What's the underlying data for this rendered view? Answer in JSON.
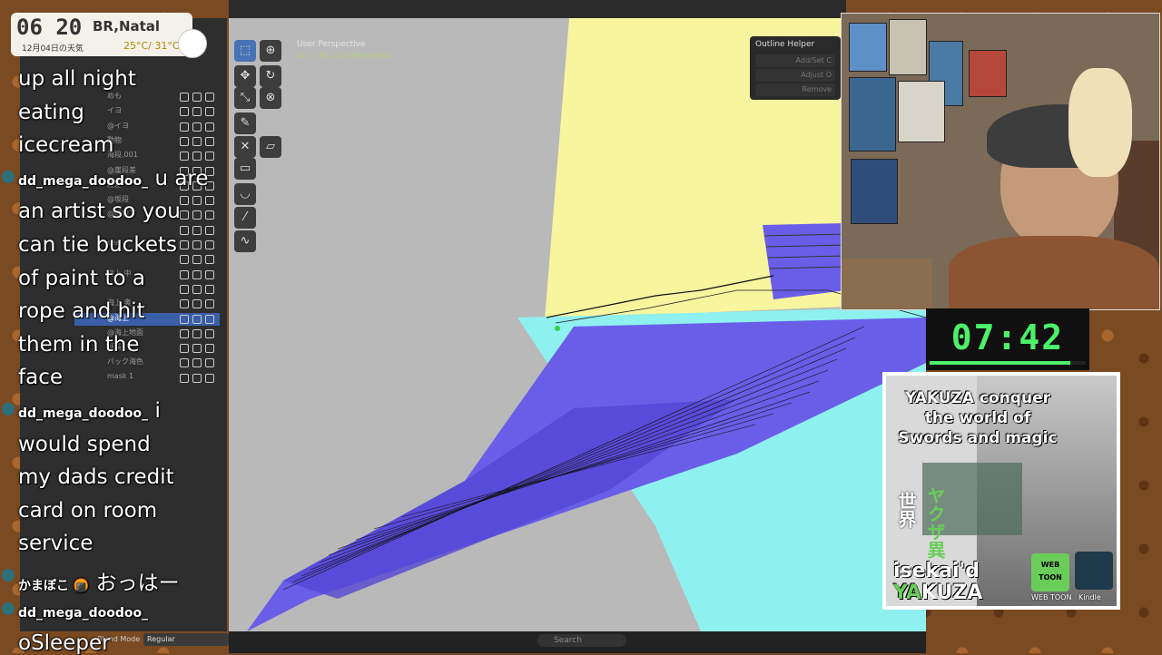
{
  "weather": {
    "time": "06 20",
    "city": "BR,Natal",
    "date": "12月04日の天気",
    "temp": "25°C/ 31°C"
  },
  "viewport": {
    "perspective": "User Perspective",
    "object_info": "(0) 2 :3k :2p | GPencil.004",
    "search_placeholder": "Search"
  },
  "outline_helper": {
    "title": "Outline Helper",
    "rows": [
      "Add/Set C",
      "Adjust O",
      "Remove"
    ]
  },
  "layers": {
    "rows": [
      "めも",
      "イヨ",
      "@イヨ",
      "動物",
      "海段.001",
      "@崖段差",
      "段差",
      "@坂段",
      "@坂段下",
      "",
      "sea",
      "",
      "海上 中",
      "",
      "海上 奥",
      "@海上",
      "@海上地面",
      "延長",
      "バック海色",
      "mask 1"
    ],
    "selected_index": 15,
    "blend_label": "Blend Mode",
    "blend_value": "Regular"
  },
  "chat": [
    {
      "type": "msg",
      "text": "up all night"
    },
    {
      "type": "msg",
      "text": "eating"
    },
    {
      "type": "msg",
      "text": "icecream"
    },
    {
      "type": "user",
      "user": "dd_mega_doodoo_",
      "text": "u are"
    },
    {
      "type": "msg",
      "text": "an artist so you"
    },
    {
      "type": "msg",
      "text": "can tie buckets"
    },
    {
      "type": "msg",
      "text": "of paint to a"
    },
    {
      "type": "msg",
      "text": "rope and hit"
    },
    {
      "type": "msg",
      "text": "them in the"
    },
    {
      "type": "msg",
      "text": "face"
    },
    {
      "type": "user",
      "user": "dd_mega_doodoo_",
      "text": "i"
    },
    {
      "type": "msg",
      "text": "would spend"
    },
    {
      "type": "msg",
      "text": "my dads credit"
    },
    {
      "type": "msg",
      "text": "card on room"
    },
    {
      "type": "msg",
      "text": "service"
    },
    {
      "type": "user",
      "user": "かまぼこ 🍘",
      "text": "おっはー"
    },
    {
      "type": "userOnly",
      "user": "dd_mega_doodoo_"
    },
    {
      "type": "msg",
      "text": "oSleeper"
    }
  ],
  "timer": {
    "text": "07:42",
    "progress": 0.9
  },
  "cover": {
    "title": "YAKUZA conquer the world of Swords and magic",
    "jp_vertical": "ヤクザ異",
    "jp_vertical2": "世界",
    "sub1": "isekai'd",
    "sub2_y": "YA",
    "sub2_rest": "KUZA",
    "badge1": "WEB TOON",
    "badge1_label": "WEB TOON",
    "badge2_label": "Kindle"
  },
  "colors": {
    "accent": "#4772b3",
    "purple": "#6a5ee8",
    "cyan": "#8ff0f0",
    "yellow": "#f7f59e",
    "timer": "#4df06a"
  }
}
